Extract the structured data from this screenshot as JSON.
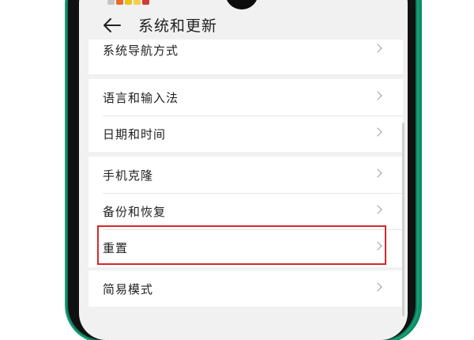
{
  "header": {
    "title": "系统和更新"
  },
  "groups": [
    {
      "items": [
        {
          "label": "系统导航方式"
        }
      ]
    },
    {
      "items": [
        {
          "label": "语言和输入法"
        },
        {
          "label": "日期和时间"
        }
      ]
    },
    {
      "items": [
        {
          "label": "手机克隆"
        },
        {
          "label": "备份和恢复"
        },
        {
          "label": "重置"
        }
      ]
    },
    {
      "items": [
        {
          "label": "简易模式"
        }
      ]
    }
  ],
  "highlighted_item": "重置",
  "colors": {
    "highlight": "#d9262c",
    "frame_accent": "#1aa07a"
  }
}
